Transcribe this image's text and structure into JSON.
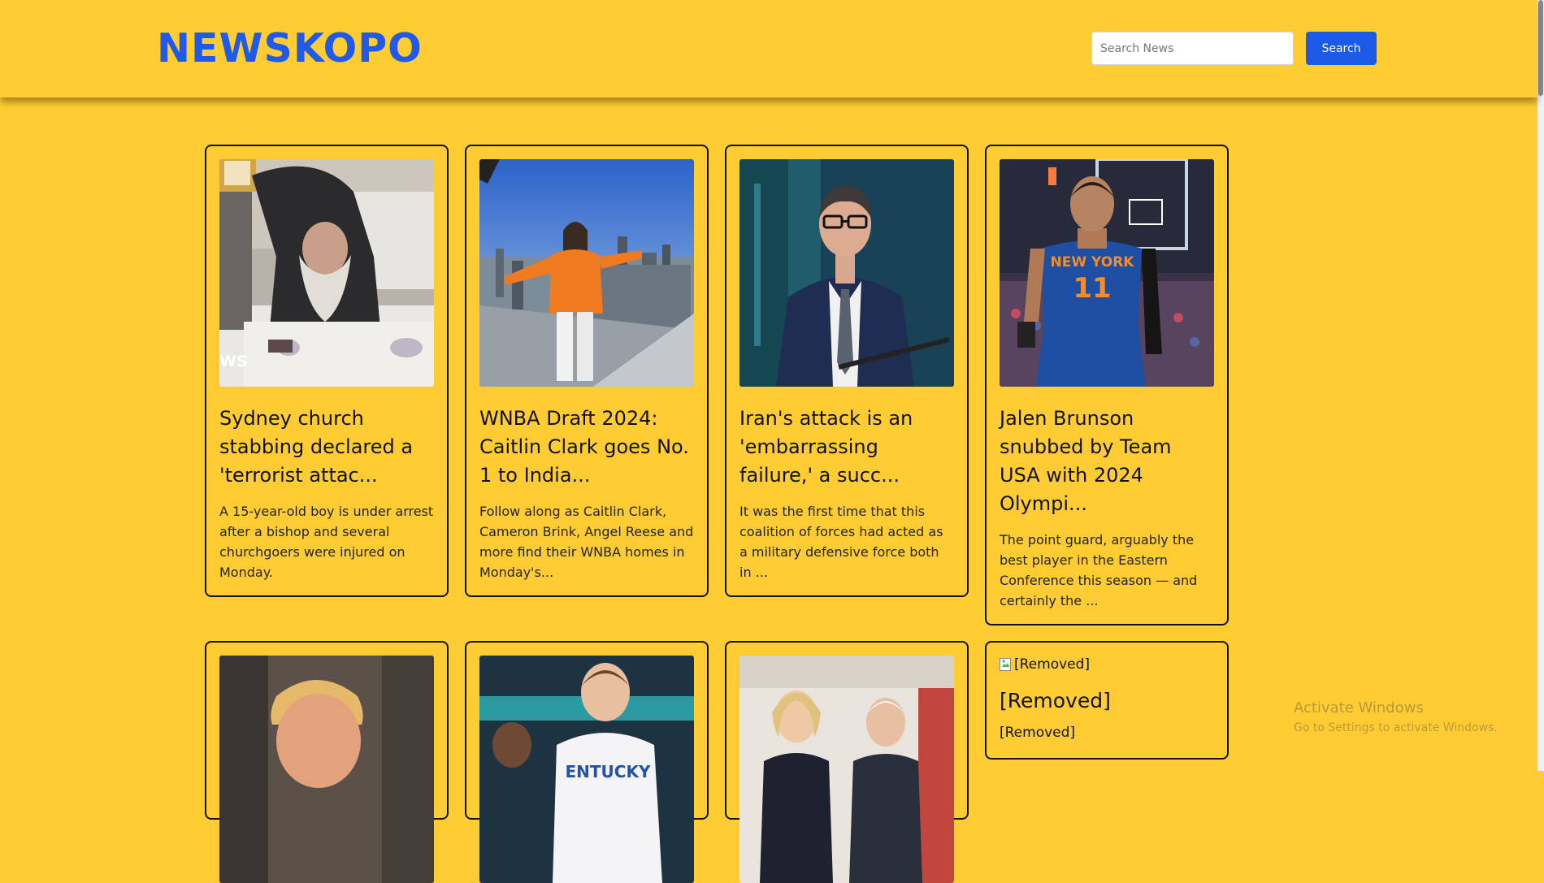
{
  "header": {
    "logo": "NEWSKOPO",
    "search_placeholder": "Search News",
    "search_button": "Search"
  },
  "articles": [
    {
      "title": "Sydney church stabbing declared a 'terrorist attac...",
      "description": "A 15-year-old boy is under arrest after a bishop and several churchgoers were injured on Monday.",
      "image_overlay_text": "WS"
    },
    {
      "title": "WNBA Draft 2024: Caitlin Clark goes No. 1 to India...",
      "description": "Follow along as Caitlin Clark, Cameron Brink, Angel Reese and more find their WNBA homes in Monday's..."
    },
    {
      "title": "Iran's attack is an 'embarrassing failure,' a succ...",
      "description": "It was the first time that this coalition of forces had acted as a military defensive force both in ..."
    },
    {
      "title": "Jalen Brunson snubbed by Team USA with 2024 Olympi...",
      "description": "The point guard, arguably the best player in the Eastern Conference this season — and certainly the ...",
      "jersey_text": "NEW YORK",
      "jersey_number": "11"
    },
    {
      "title": "",
      "description": ""
    },
    {
      "title": "",
      "description": "",
      "jersey_text": "ENTUCKY"
    },
    {
      "title": "",
      "description": ""
    },
    {
      "image_alt": "[Removed]",
      "title": "[Removed]",
      "description": "[Removed]"
    }
  ],
  "watermark": {
    "title": "Activate Windows",
    "subtitle": "Go to Settings to activate Windows."
  },
  "colors": {
    "background": "#ffcd33",
    "accent_blue": "#1f5ae8",
    "button_blue": "#1a5ae6",
    "card_border": "#111111"
  }
}
